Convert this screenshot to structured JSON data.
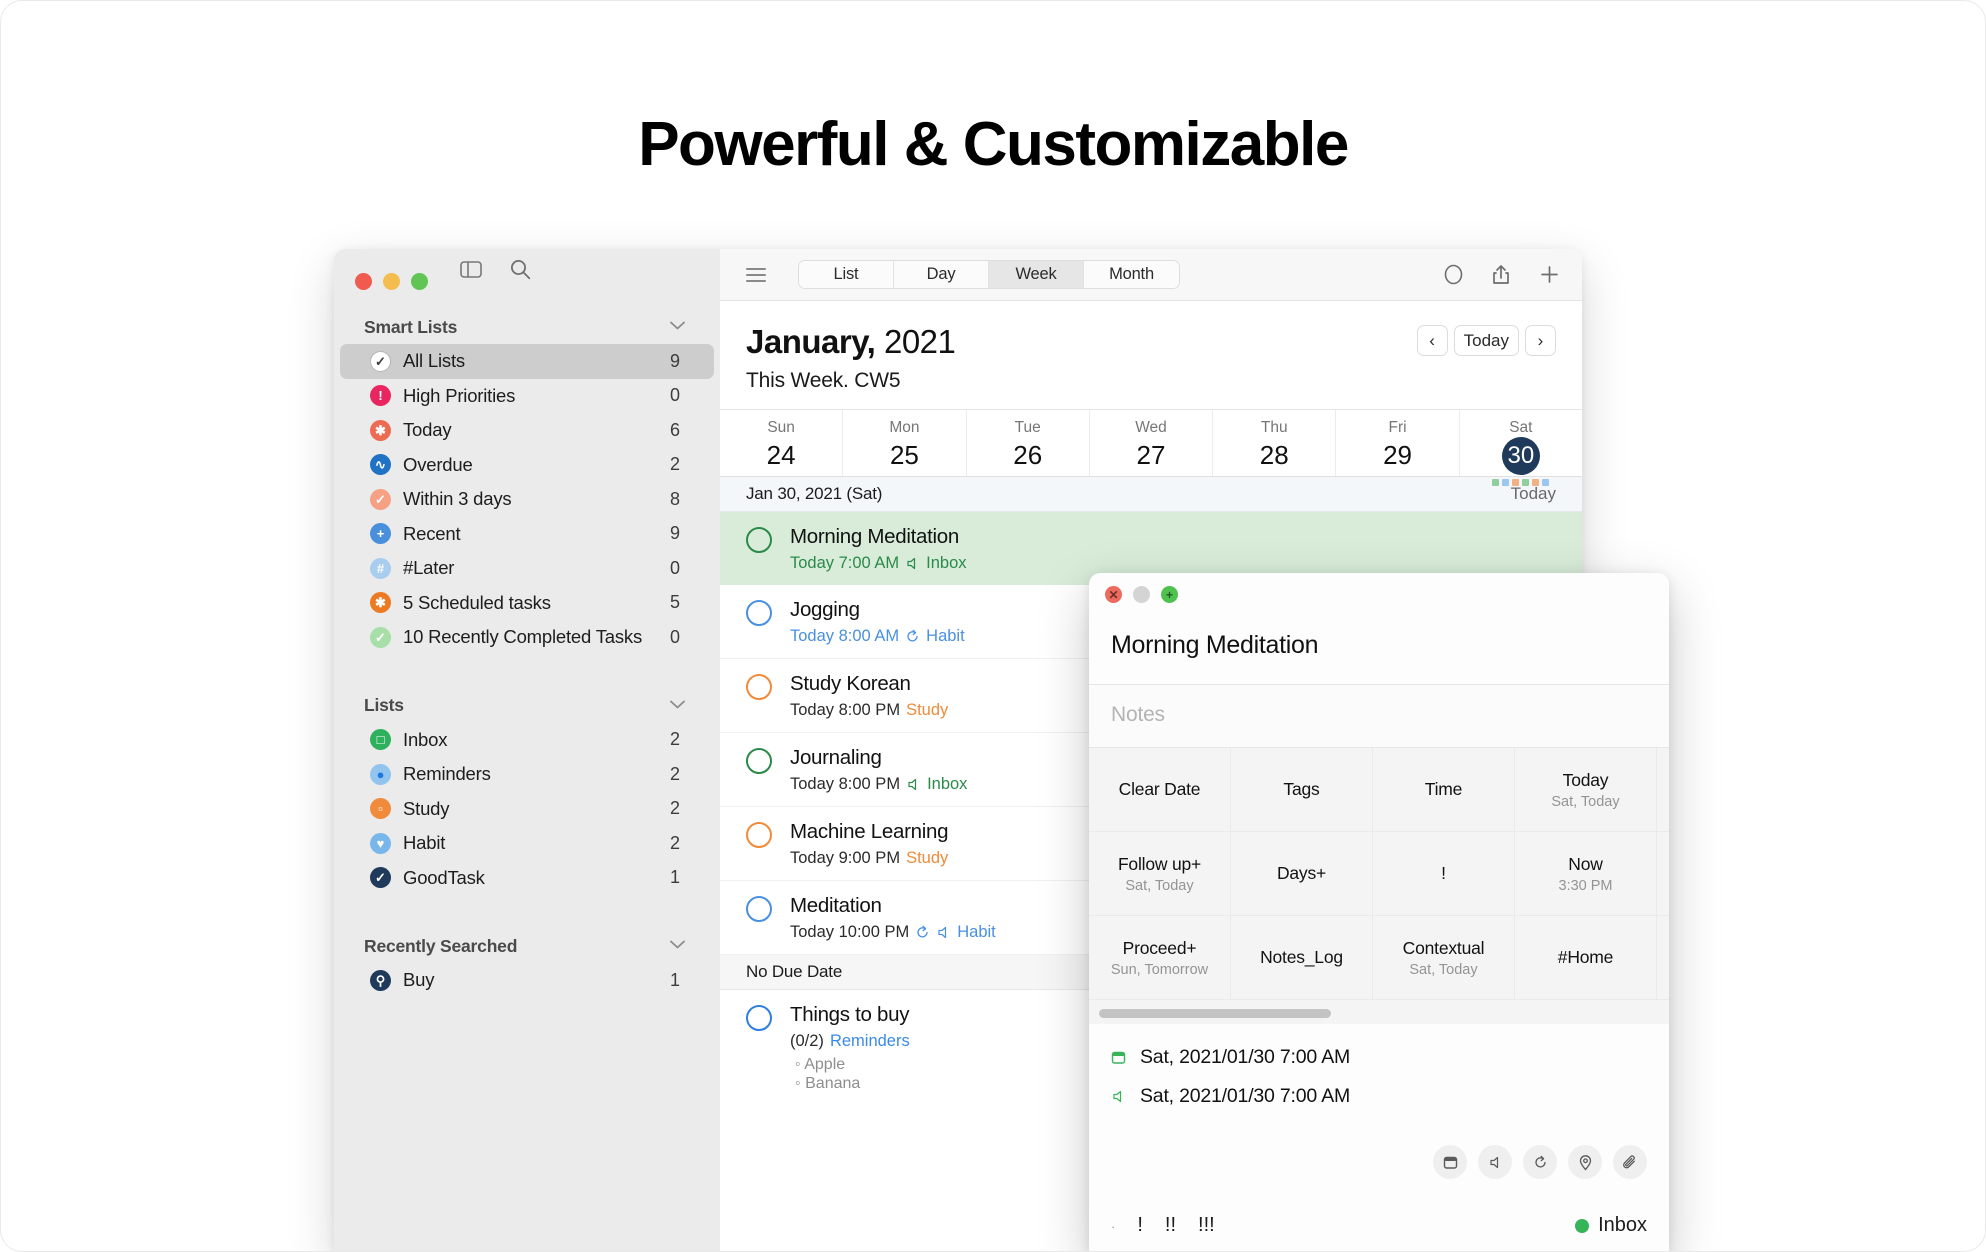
{
  "headline": "Powerful & Customizable",
  "sidebar": {
    "window_controls": [
      "close",
      "minimize",
      "zoom"
    ],
    "tools": [
      "sidebar-toggle-icon",
      "search-icon"
    ],
    "sections": [
      {
        "label": "Smart Lists",
        "items": [
          {
            "label": "All Lists",
            "count": "9",
            "icon": "check-circle-icon",
            "color": "#ffffff",
            "glyph": "✓",
            "glyph_color": "#3a3a3a",
            "bordered": true,
            "active": true
          },
          {
            "label": "High Priorities",
            "count": "0",
            "icon": "exclamation-circle-icon",
            "color": "#e8255f",
            "glyph": "!"
          },
          {
            "label": "Today",
            "count": "6",
            "icon": "asterisk-circle-icon",
            "color": "#ec6b52",
            "glyph": "✱"
          },
          {
            "label": "Overdue",
            "count": "2",
            "icon": "wave-circle-icon",
            "color": "#1f72c4",
            "glyph": "∿"
          },
          {
            "label": "Within 3 days",
            "count": "8",
            "icon": "check-circle-icon",
            "color": "#f6a183",
            "glyph": "✓"
          },
          {
            "label": "Recent",
            "count": "9",
            "icon": "plus-circle-icon",
            "color": "#4a8fdc",
            "glyph": "+"
          },
          {
            "label": "#Later",
            "count": "0",
            "icon": "hash-circle-icon",
            "color": "#a8cdef",
            "glyph": "#"
          },
          {
            "label": "5 Scheduled tasks",
            "count": "5",
            "icon": "asterisk-circle-icon",
            "color": "#ec7a23",
            "glyph": "✱"
          },
          {
            "label": "10 Recently Completed Tasks",
            "count": "0",
            "icon": "check-circle-icon",
            "color": "#a8dfa8",
            "glyph": "✓"
          }
        ]
      },
      {
        "label": "Lists",
        "items": [
          {
            "label": "Inbox",
            "count": "2",
            "icon": "inbox-circle-icon",
            "color": "#2eb15c",
            "glyph": "□"
          },
          {
            "label": "Reminders",
            "count": "2",
            "icon": "dot-circle-icon",
            "color": "#92c4f0",
            "glyph": "●",
            "glyph_color": "#1f77d9"
          },
          {
            "label": "Study",
            "count": "2",
            "icon": "book-circle-icon",
            "color": "#ef8b3a",
            "glyph": "▫"
          },
          {
            "label": "Habit",
            "count": "2",
            "icon": "heart-circle-icon",
            "color": "#79b7ea",
            "glyph": "♥"
          },
          {
            "label": "GoodTask",
            "count": "1",
            "icon": "check-circle-icon",
            "color": "#1f3a5a",
            "glyph": "✓"
          }
        ]
      },
      {
        "label": "Recently Searched",
        "items": [
          {
            "label": "Buy",
            "count": "1",
            "icon": "search-circle-icon",
            "color": "#1f3a5a",
            "glyph": "⚲"
          }
        ]
      }
    ]
  },
  "toolbar": {
    "menu_icon": "hamburger-icon",
    "segments": [
      {
        "label": "List",
        "active": false
      },
      {
        "label": "Day",
        "active": false
      },
      {
        "label": "Week",
        "active": true
      },
      {
        "label": "Month",
        "active": false
      }
    ],
    "right_icons": [
      "circle-icon",
      "share-icon",
      "plus-icon"
    ]
  },
  "calendar": {
    "month_bold": "January,",
    "month_year": "2021",
    "week_subtitle": "This Week. CW5",
    "nav": {
      "prev": "‹",
      "today": "Today",
      "next": "›"
    },
    "days": [
      {
        "dow": "Sun",
        "num": "24",
        "today": false
      },
      {
        "dow": "Mon",
        "num": "25",
        "today": false
      },
      {
        "dow": "Tue",
        "num": "26",
        "today": false
      },
      {
        "dow": "Wed",
        "num": "27",
        "today": false
      },
      {
        "dow": "Thu",
        "num": "28",
        "today": false
      },
      {
        "dow": "Fri",
        "num": "29",
        "today": false
      },
      {
        "dow": "Sat",
        "num": "30",
        "today": true,
        "dots": [
          "#8fce9e",
          "#9ec6ef",
          "#f2b183",
          "#8fce9e",
          "#f2b183",
          "#9ec6ef"
        ]
      }
    ]
  },
  "day_section": {
    "label": "Jan 30, 2021 (Sat)",
    "right": "Today"
  },
  "tasks": [
    {
      "title": "Morning Meditation",
      "time": "Today 7:00 AM",
      "list": "Inbox",
      "color": "#2b8a4a",
      "meta_color": "#2b8a4a",
      "list_color": "#2b8a4a",
      "icons": [
        "alert-icon"
      ],
      "highlight": true
    },
    {
      "title": "Jogging",
      "time": "Today 8:00 AM",
      "list": "Habit",
      "color": "#4a90e2",
      "meta_color": "#4a90e2",
      "list_color": "#4a90e2",
      "icons": [
        "repeat-icon"
      ],
      "highlight": false
    },
    {
      "title": "Study Korean",
      "time": "Today 8:00 PM",
      "list": "Study",
      "color": "#ef8b3a",
      "meta_color": "#2b2b2b",
      "list_color": "#ef8b3a",
      "icons": [],
      "highlight": false
    },
    {
      "title": "Journaling",
      "time": "Today 8:00 PM",
      "list": "Inbox",
      "color": "#2b8a4a",
      "meta_color": "#2b2b2b",
      "list_color": "#2b8a4a",
      "icons": [
        "alert-icon"
      ],
      "highlight": false
    },
    {
      "title": "Machine Learning",
      "time": "Today 9:00 PM",
      "list": "Study",
      "color": "#ef8b3a",
      "meta_color": "#2b2b2b",
      "list_color": "#ef8b3a",
      "icons": [],
      "highlight": false
    },
    {
      "title": "Meditation",
      "time": "Today 10:00 PM",
      "list": "Habit",
      "color": "#4a90e2",
      "meta_color": "#2b2b2b",
      "list_color": "#4a90e2",
      "icons": [
        "repeat-icon",
        "alert-icon"
      ],
      "highlight": false
    }
  ],
  "no_due_section": {
    "label": "No Due Date"
  },
  "no_due_task": {
    "title": "Things to buy",
    "progress": "(0/2)",
    "list": "Reminders",
    "list_color": "#3b8ae8",
    "color": "#2e7fe0",
    "subitems": [
      "Apple",
      "Banana"
    ]
  },
  "detail": {
    "window_controls": [
      "close",
      "minimize",
      "zoom"
    ],
    "title": "Morning Meditation",
    "notes_placeholder": "Notes",
    "grid": [
      [
        {
          "main": "Clear Date",
          "sub": ""
        },
        {
          "main": "Tags",
          "sub": ""
        },
        {
          "main": "Time",
          "sub": ""
        },
        {
          "main": "Today",
          "sub": "Sat, Today"
        }
      ],
      [
        {
          "main": "Follow up+",
          "sub": "Sat, Today"
        },
        {
          "main": "Days+",
          "sub": ""
        },
        {
          "main": "!",
          "sub": ""
        },
        {
          "main": "Now",
          "sub": "3:30 PM"
        }
      ],
      [
        {
          "main": "Proceed+",
          "sub": "Sun, Tomorrow"
        },
        {
          "main": "Notes_Log",
          "sub": ""
        },
        {
          "main": "Contextual",
          "sub": "Sat, Today"
        },
        {
          "main": "#Home",
          "sub": ""
        }
      ]
    ],
    "dates": [
      {
        "icon": "calendar-icon",
        "text": "Sat, 2021/01/30 7:00 AM"
      },
      {
        "icon": "alert-icon",
        "text": "Sat, 2021/01/30 7:00 AM"
      }
    ],
    "action_icons": [
      "calendar-icon",
      "alert-icon",
      "repeat-icon",
      "location-icon",
      "attachment-icon"
    ],
    "priorities": [
      "·",
      "!",
      "!!",
      "!!!"
    ],
    "list_name": "Inbox",
    "list_color": "#35b558"
  }
}
